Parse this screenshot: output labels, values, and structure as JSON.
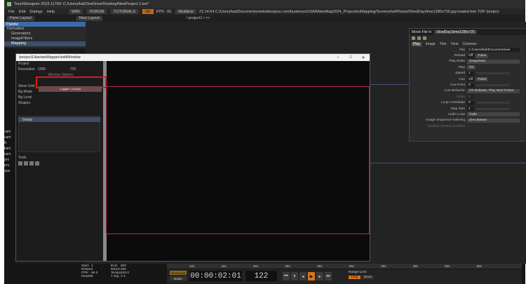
{
  "titlebar": {
    "title": "TouchDesigner 2023.11760: C:/Users/kat/OneDrive/Desktop/NewProject.1.toe*"
  },
  "menu": [
    "File",
    "Edit",
    "Dialogs",
    "Help"
  ],
  "toptags": {
    "wiki": "WIKI",
    "forum": "FORUM",
    "tutorials": "TUTORIALS",
    "warn": "OK",
    "fps_label": "FPS:",
    "fps": "60",
    "realtime": "Realtime",
    "status": "21:14:54 C:/Users/kat/Documents/website/vjoss.com/business/USA/MakeMag2024_ProjectionMapping/ScreenshotPhotos/ShedDay/time1280x720.jpg loaded into TOP /project"
  },
  "toolbar2": {
    "pane_layout": "Pane Layout",
    "new_layout": "New Layout",
    "path": "/ project1 / >>"
  },
  "palette": {
    "header": "Palette",
    "items": [
      "Derivative",
      "Generators",
      "ImageFilters",
      "Mapping"
    ]
  },
  "left_list": [
    "cam",
    "cam",
    "lk",
    "kam",
    "sam",
    "pro",
    "pro",
    "qua",
    "stor",
    "sav"
  ],
  "editwin": {
    "title": "/project1/kantanMapper/editWindow",
    "params": {
      "project": "Project",
      "resolution_label": "Resolution",
      "res_w": "1280",
      "res_h": "720",
      "window_options": "Window Options",
      "toggle_output": "Toggle Output",
      "show_grid": "Show Grid",
      "bg_mode": "Bg Mode",
      "bg_level": "Bg Level",
      "shapes": "Shapes",
      "group": "Group",
      "tools": "Tools"
    }
  },
  "movie": {
    "header": "Movie File In",
    "node_name": "ShedDay1time1280x720",
    "tabs": [
      "Play",
      "Image",
      "Trim",
      "Tune",
      "Common"
    ],
    "params": [
      {
        "label": "File",
        "value": "C:/Users/kat/Documents/we"
      },
      {
        "label": "Reload",
        "value": "Off",
        "value2": "Pulse"
      },
      {
        "label": "Play Mode",
        "value": "Sequential"
      },
      {
        "label": "Play",
        "value": "On"
      },
      {
        "label": "Speed",
        "value": "1"
      },
      {
        "label": "Cue",
        "value": "Off",
        "value2": "Pulse"
      },
      {
        "label": "Cue Point",
        "value": "0"
      },
      {
        "label": "Cue Behavior",
        "value": "On Release, Play Next Frame"
      },
      {
        "label": "Index",
        "value": "0"
      },
      {
        "label": "Loop Crossfade",
        "value": "0"
      },
      {
        "label": "Step Size",
        "value": "1"
      },
      {
        "label": "Audio Loop",
        "value": "Fade"
      },
      {
        "label": "Image Sequence Indexing",
        "value": "Zero Based"
      },
      {
        "label": "Timeline Stretch Conflicts",
        "value": ""
      }
    ]
  },
  "timeline": {
    "start_label": "Start:",
    "start": "1",
    "end_label": "End:",
    "end": "600",
    "rstart_label": "RStart:",
    "rstart": "1",
    "rend_label": "REnd:",
    "rend": "600",
    "fps_label": "FPS:",
    "fps": "60.0",
    "tempo_label": "Tempo:",
    "tempo": "120.0",
    "resetf_label": "ResetF:",
    "resetf": "1",
    "tsig_label": "T Sig:",
    "tsig": "4  4",
    "timecode_btn": "TimeCode",
    "beats_btn": "Beats",
    "timecode": "00:00:02:01",
    "frame": "122",
    "range_limit": "Range Limit",
    "loop": "Loop",
    "once": "Once"
  },
  "ruler": [
    "101",
    "151",
    "201",
    "251",
    "301",
    "351",
    "401",
    "451",
    "501",
    "551"
  ]
}
